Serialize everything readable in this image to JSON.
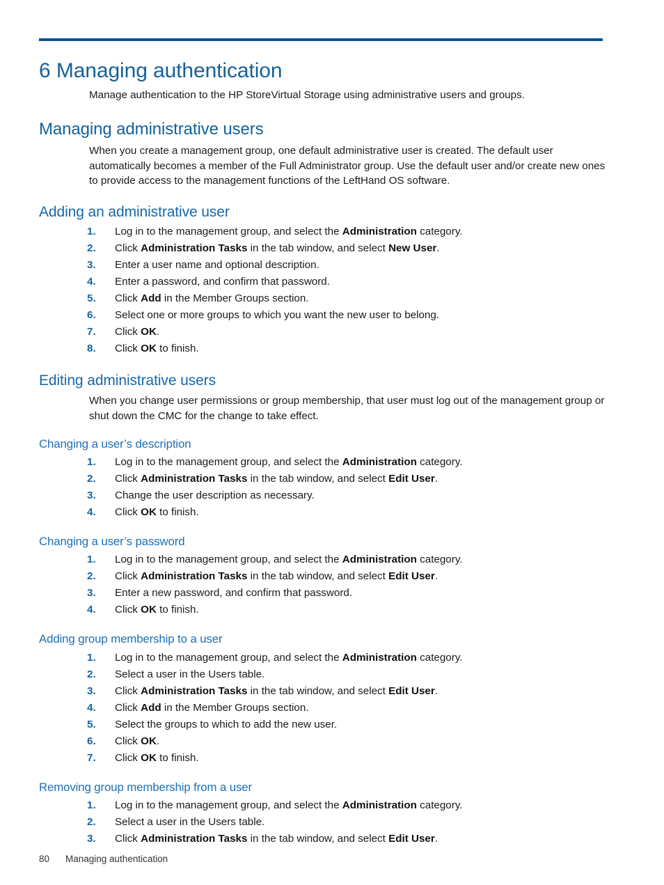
{
  "document": {
    "chapter_title": "6 Managing authentication",
    "intro": "Manage authentication to the HP StoreVirtual Storage using administrative users and groups.",
    "footer": {
      "page_number": "80",
      "running_head": "Managing authentication"
    },
    "accent_color": "#0a5490",
    "heading_color": "#14619b",
    "subheading_color": "#1c6fb5"
  },
  "sections": {
    "managing_admin_users": {
      "heading": "Managing administrative users",
      "body": "When you create a management group, one default administrative user is created. The default user automatically becomes a member of the Full Administrator group. Use the default user and/or create new ones to provide access to the management functions of the LeftHand OS software."
    },
    "adding_admin_user": {
      "heading": "Adding an administrative user",
      "steps": [
        {
          "num": "1.",
          "html": "Log in to the management group, and select the <b>Administration</b> category."
        },
        {
          "num": "2.",
          "html": "Click <b>Administration Tasks</b> in the tab window, and select <b>New User</b>."
        },
        {
          "num": "3.",
          "html": "Enter a user name and optional description."
        },
        {
          "num": "4.",
          "html": "Enter a password, and confirm that password."
        },
        {
          "num": "5.",
          "html": "Click <b>Add</b> in the Member Groups section."
        },
        {
          "num": "6.",
          "html": "Select one or more groups to which you want the new user to belong."
        },
        {
          "num": "7.",
          "html": "Click <b>OK</b>."
        },
        {
          "num": "8.",
          "html": "Click <b>OK</b> to finish."
        }
      ]
    },
    "editing_admin_users": {
      "heading": "Editing administrative users",
      "body": "When you change user permissions or group membership, that user must log out of the management group or shut down the CMC for the change to take effect."
    },
    "changing_description": {
      "heading": "Changing a user’s description",
      "steps": [
        {
          "num": "1.",
          "html": "Log in to the management group, and select the <b>Administration</b> category."
        },
        {
          "num": "2.",
          "html": "Click <b>Administration Tasks</b> in the tab window, and select <b>Edit User</b>."
        },
        {
          "num": "3.",
          "html": "Change the user description as necessary."
        },
        {
          "num": "4.",
          "html": "Click <b>OK</b> to finish."
        }
      ]
    },
    "changing_password": {
      "heading": "Changing a user’s password",
      "steps": [
        {
          "num": "1.",
          "html": "Log in to the management group, and select the <b>Administration</b> category."
        },
        {
          "num": "2.",
          "html": "Click <b>Administration Tasks</b> in the tab window, and select <b>Edit User</b>."
        },
        {
          "num": "3.",
          "html": "Enter a new password, and confirm that password."
        },
        {
          "num": "4.",
          "html": "Click <b>OK</b> to finish."
        }
      ]
    },
    "adding_group_membership": {
      "heading": "Adding group membership to a user",
      "steps": [
        {
          "num": "1.",
          "html": "Log in to the management group, and select the <b>Administration</b> category."
        },
        {
          "num": "2.",
          "html": "Select a user in the Users table."
        },
        {
          "num": "3.",
          "html": "Click <b>Administration Tasks</b> in the tab window, and select <b>Edit User</b>."
        },
        {
          "num": "4.",
          "html": "Click <b>Add</b> in the Member Groups section."
        },
        {
          "num": "5.",
          "html": "Select the groups to which to add the new user."
        },
        {
          "num": "6.",
          "html": "Click <b>OK</b>."
        },
        {
          "num": "7.",
          "html": "Click <b>OK</b> to finish."
        }
      ]
    },
    "removing_group_membership": {
      "heading": "Removing group membership from a user",
      "steps": [
        {
          "num": "1.",
          "html": "Log in to the management group, and select the <b>Administration</b> category."
        },
        {
          "num": "2.",
          "html": "Select a user in the Users table."
        },
        {
          "num": "3.",
          "html": "Click <b>Administration Tasks</b> in the tab window, and select <b>Edit User</b>."
        }
      ]
    }
  }
}
